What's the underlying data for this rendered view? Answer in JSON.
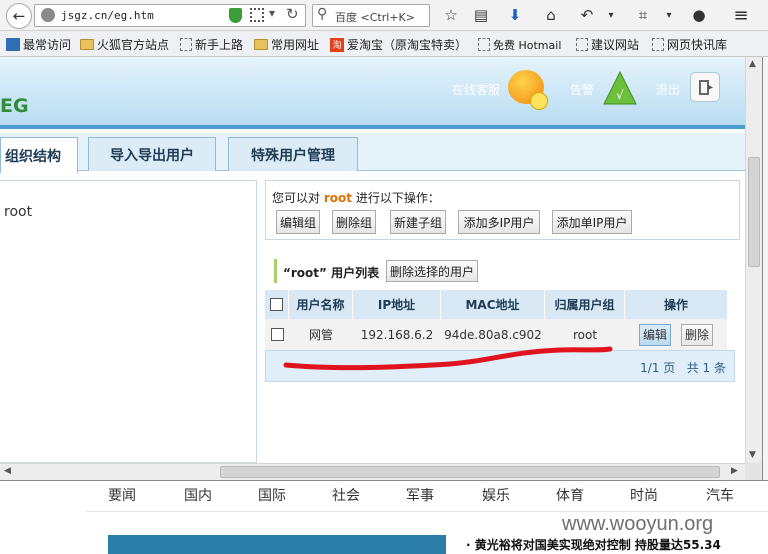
{
  "browser": {
    "url": "jsgz.cn/eg.htm",
    "search_placeholder": "百度 <Ctrl+K>",
    "bookmarks": [
      "最常访问",
      "火狐官方站点",
      "新手上路",
      "常用网址",
      "爱淘宝（原淘宝特卖）",
      "免费 Hotmail",
      "建议网站",
      "网页快讯库"
    ]
  },
  "header": {
    "logo": "EG",
    "online_service": "在线客服",
    "alarm": "告警",
    "logout": "退出"
  },
  "tabs": [
    "组织结构",
    "导入导出用户",
    "特殊用户管理"
  ],
  "tree": {
    "root": "root"
  },
  "ops": {
    "prefix": "您可以对",
    "target": "root",
    "suffix": "进行以下操作：",
    "buttons": [
      "编辑组",
      "删除组",
      "新建子组",
      "添加多IP用户",
      "添加单IP用户"
    ]
  },
  "list": {
    "title": "“root” 用户列表",
    "delete_selected": "删除选择的用户",
    "columns": [
      "用户名称",
      "IP地址",
      "MAC地址",
      "归属用户组",
      "操作"
    ],
    "rows": [
      {
        "name": "网管",
        "ip": "192.168.6.2",
        "mac": "94de.80a8.c902",
        "group": "root",
        "edit": "编辑",
        "delete": "删除"
      }
    ],
    "pagination": "1/1 页   共 1 条"
  },
  "bottom_nav": [
    "要闻",
    "国内",
    "国际",
    "社会",
    "军事",
    "娱乐",
    "体育",
    "时尚",
    "汽车"
  ],
  "headline": "· 黄光裕将对国美实现绝对控制 持股量达55.34",
  "watermark": "www.wooyun.org",
  "colors": {
    "accent_blue": "#4a9fd0",
    "highlight_orange": "#e07000",
    "red_mark": "#e0141e"
  }
}
